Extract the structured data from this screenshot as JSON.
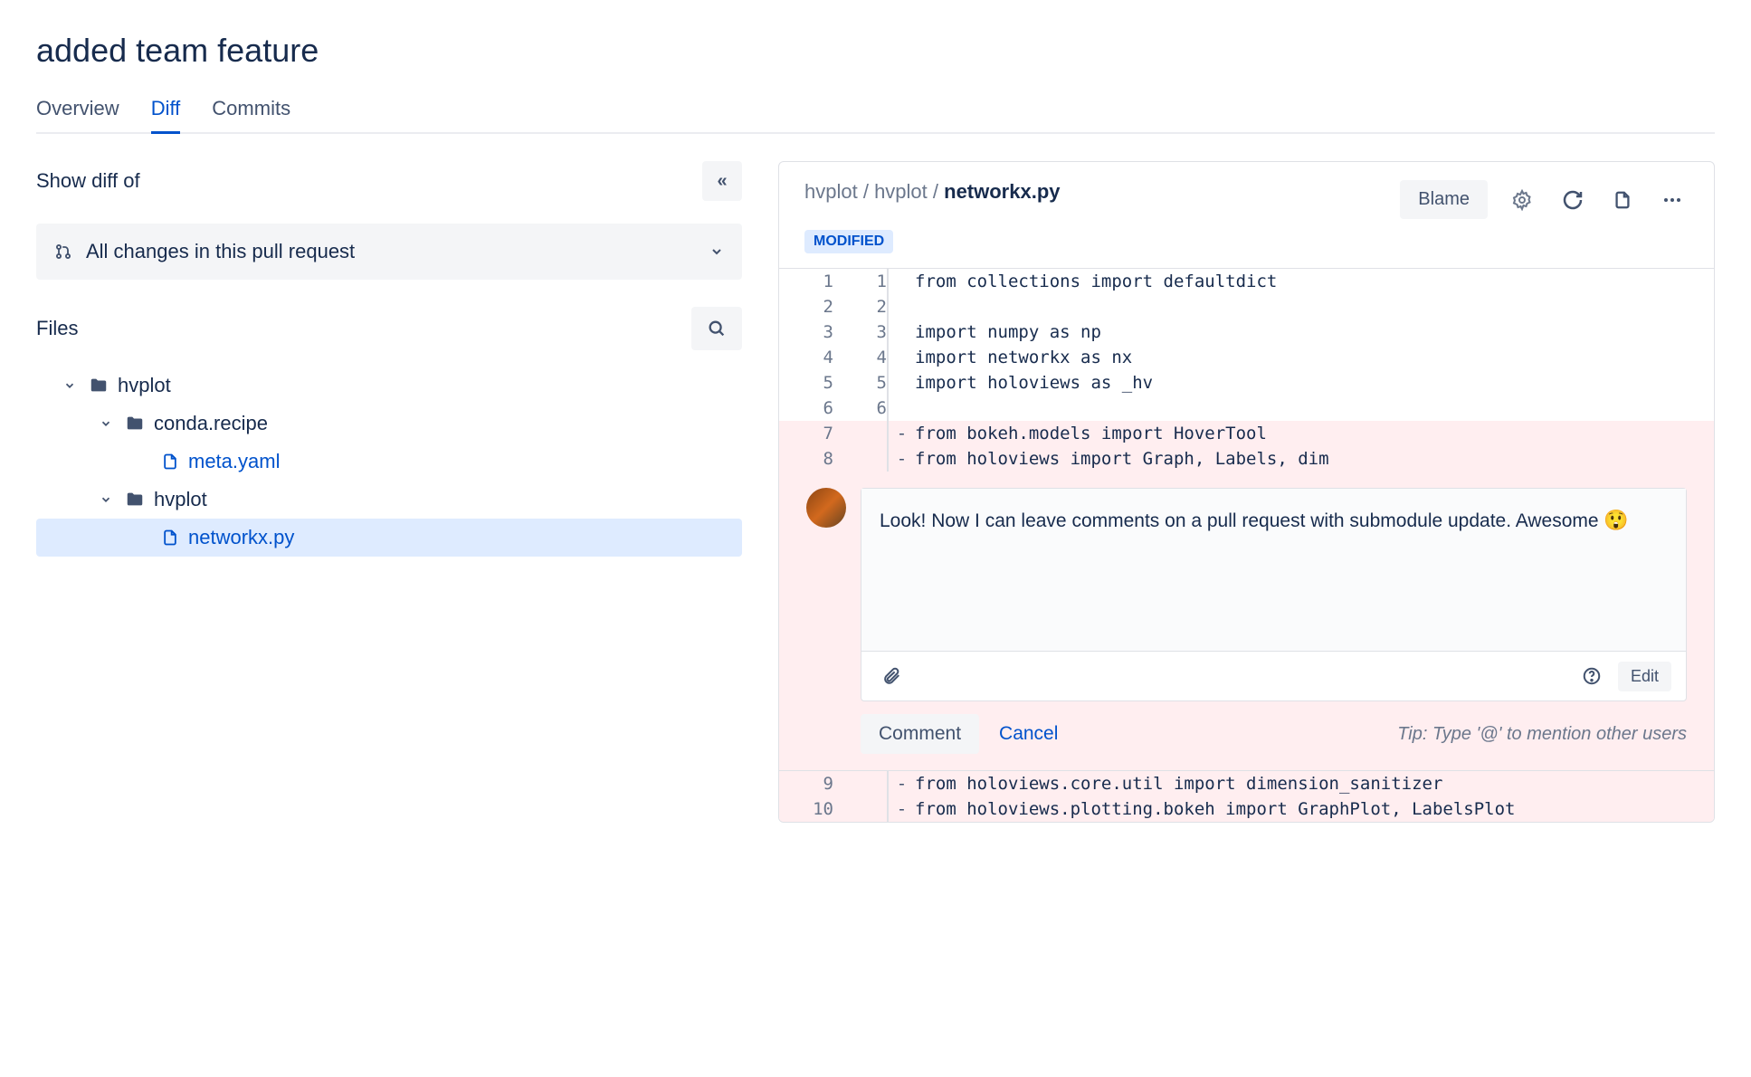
{
  "page_title": "added team feature",
  "tabs": [
    {
      "label": "Overview",
      "active": false
    },
    {
      "label": "Diff",
      "active": true
    },
    {
      "label": "Commits",
      "active": false
    }
  ],
  "sidebar": {
    "title": "Show diff of",
    "diff_selector": "All changes in this pull request",
    "files_title": "Files",
    "tree": [
      {
        "label": "hvplot",
        "type": "folder",
        "level": 1
      },
      {
        "label": "conda.recipe",
        "type": "folder",
        "level": 2
      },
      {
        "label": "meta.yaml",
        "type": "file",
        "level": 3,
        "link": true
      },
      {
        "label": "hvplot",
        "type": "folder",
        "level": 2
      },
      {
        "label": "networkx.py",
        "type": "file",
        "level": 3,
        "link": true,
        "selected": true
      }
    ]
  },
  "file": {
    "breadcrumb": [
      "hvplot",
      "hvplot",
      "networkx.py"
    ],
    "blame_label": "Blame",
    "badge": "MODIFIED"
  },
  "diff_lines": [
    {
      "old": "1",
      "new": "1",
      "marker": "",
      "code": "from collections import defaultdict",
      "type": "ctx"
    },
    {
      "old": "2",
      "new": "2",
      "marker": "",
      "code": "",
      "type": "ctx"
    },
    {
      "old": "3",
      "new": "3",
      "marker": "",
      "code": "import numpy as np",
      "type": "ctx"
    },
    {
      "old": "4",
      "new": "4",
      "marker": "",
      "code": "import networkx as nx",
      "type": "ctx"
    },
    {
      "old": "5",
      "new": "5",
      "marker": "",
      "code": "import holoviews as _hv",
      "type": "ctx"
    },
    {
      "old": "6",
      "new": "6",
      "marker": "",
      "code": "",
      "type": "ctx"
    },
    {
      "old": "7",
      "new": "",
      "marker": "-",
      "code": "from bokeh.models import HoverTool",
      "type": "removed"
    },
    {
      "old": "8",
      "new": "",
      "marker": "-",
      "code": "from holoviews import Graph, Labels, dim",
      "type": "removed"
    }
  ],
  "diff_lines_after": [
    {
      "old": "9",
      "new": "",
      "marker": "-",
      "code": "from holoviews.core.util import dimension_sanitizer",
      "type": "removed"
    },
    {
      "old": "10",
      "new": "",
      "marker": "-",
      "code": "from holoviews.plotting.bokeh import GraphPlot, LabelsPlot",
      "type": "removed"
    }
  ],
  "comment": {
    "text": "Look! Now I can leave comments on a pull request with submodule update. Awesome ",
    "emoji": "😲",
    "edit_label": "Edit",
    "comment_btn": "Comment",
    "cancel_btn": "Cancel",
    "tip": "Tip: Type '@' to mention other users"
  }
}
